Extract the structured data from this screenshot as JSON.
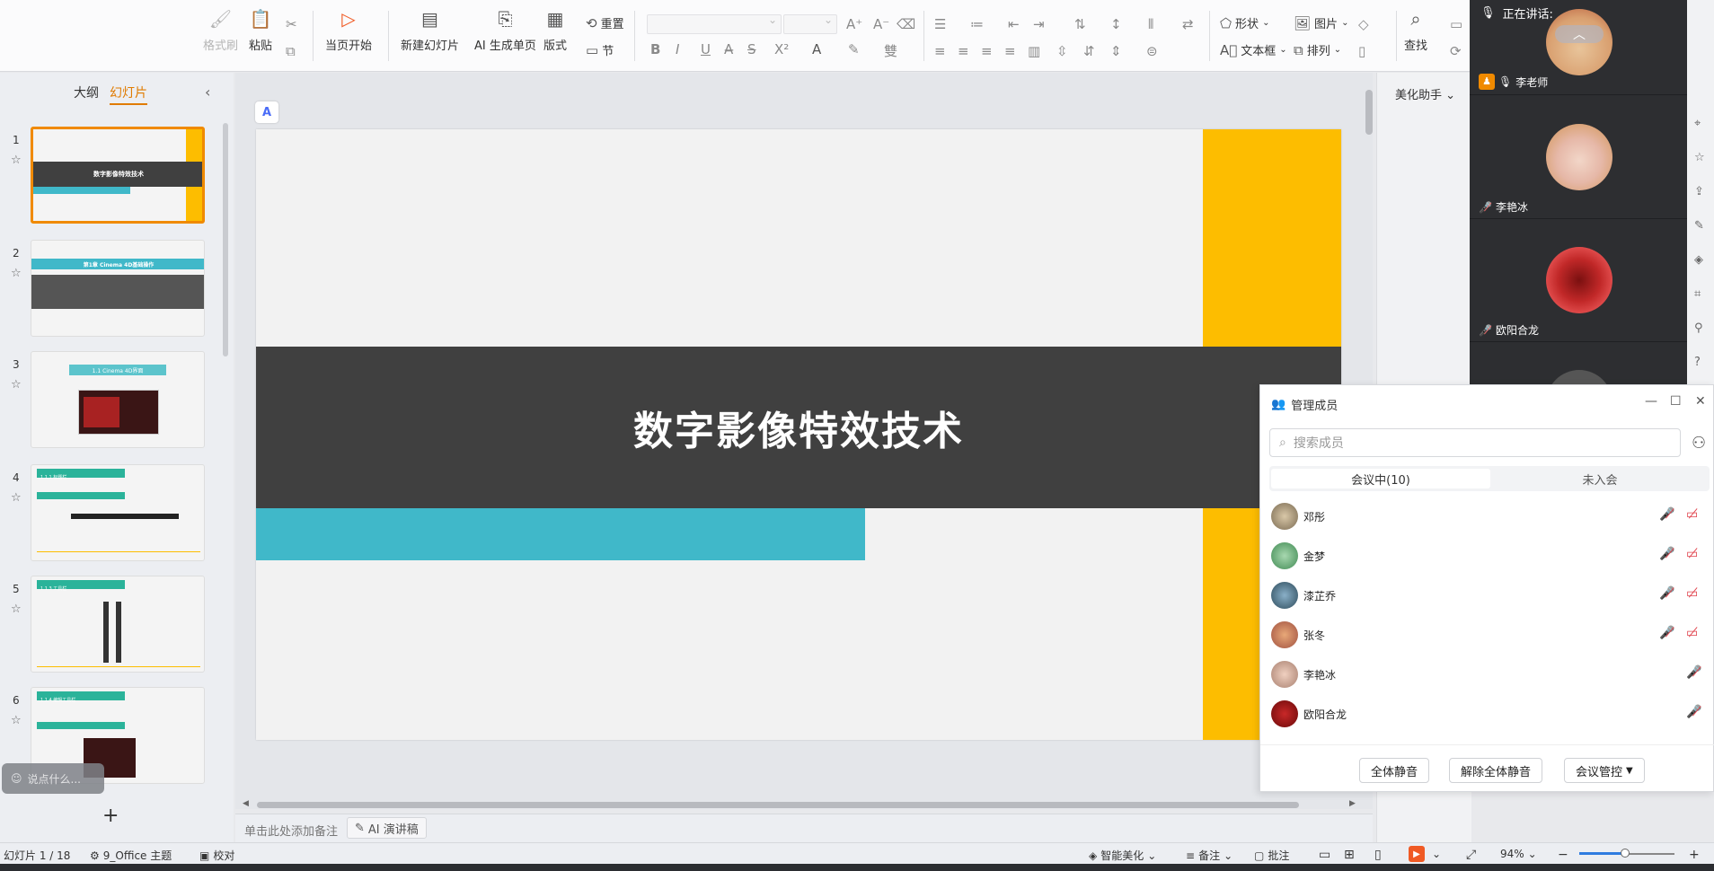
{
  "ribbon": {
    "format_painter": "格式刷",
    "paste": "粘贴",
    "from_current": "当页开始",
    "new_slide": "新建幻灯片",
    "ai_generate": "AI 生成单页",
    "layout": "版式",
    "reset": "重置",
    "section": "节",
    "shape": "形状",
    "picture": "图片",
    "textbox": "文本框",
    "arrange": "排列",
    "find": "查找"
  },
  "left_panel": {
    "tab_outline": "大纲",
    "tab_slides": "幻灯片",
    "chat_placeholder": "说点什么...",
    "thumbnails": [
      {
        "number": "1",
        "title": "数字影像特效技术"
      },
      {
        "number": "2",
        "title": "第1章 Cinema 4D基础操作"
      },
      {
        "number": "3",
        "title": "1.1 Cinema 4D界面"
      },
      {
        "number": "4",
        "title": "1.1.1 标题栏"
      },
      {
        "number": "5",
        "title": "1.1.3 工具栏"
      },
      {
        "number": "6",
        "title": "1.1.4 编辑工具栏"
      }
    ]
  },
  "slide": {
    "title": "数字影像特效技术",
    "colors": {
      "yellow": "#fdbd00",
      "dark": "#404040",
      "teal": "#40b8c9",
      "background": "#f2f2f2"
    }
  },
  "notes": {
    "placeholder": "单击此处添加备注",
    "ai_script": "AI 演讲稿"
  },
  "assistant": {
    "title": "美化助手"
  },
  "statusbar": {
    "slide_counter": "幻灯片 1 / 18",
    "theme": "9_Office 主题",
    "proofread": "校对",
    "smart_beautify": "智能美化",
    "notes": "备注",
    "comments": "批注",
    "zoom": "94%"
  },
  "video_panel": {
    "speaking_label": "正在讲话:",
    "participants": [
      {
        "name": "李老师",
        "role": "host"
      },
      {
        "name": "李艳冰"
      },
      {
        "name": "欧阳合龙"
      }
    ]
  },
  "member_panel": {
    "title": "管理成员",
    "search_placeholder": "搜索成员",
    "tab_in_meeting": "会议中(10)",
    "tab_not_joined": "未入会",
    "members": [
      {
        "name": "邓彤"
      },
      {
        "name": "金梦"
      },
      {
        "name": "漆芷乔"
      },
      {
        "name": "张冬"
      },
      {
        "name": "李艳冰"
      },
      {
        "name": "欧阳合龙"
      }
    ],
    "mute_all": "全体静音",
    "unmute_all": "解除全体静音",
    "meeting_control": "会议管控"
  }
}
